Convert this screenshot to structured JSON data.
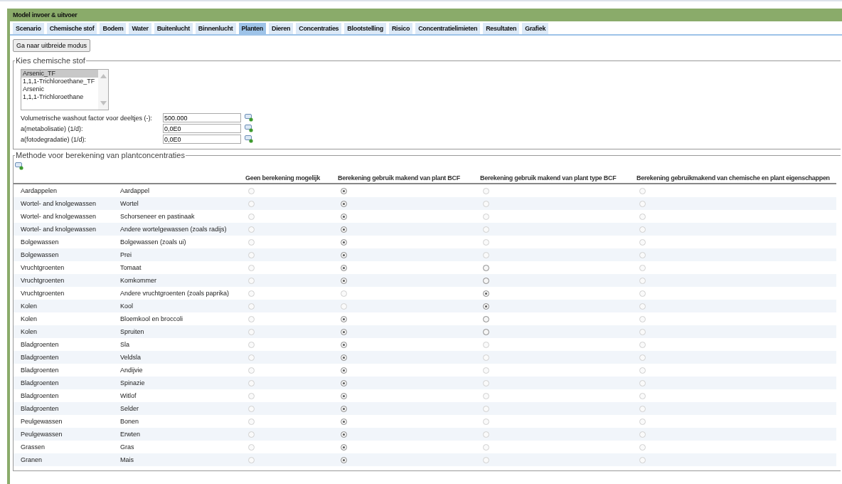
{
  "window": {
    "title": "Model invoer & uitvoer"
  },
  "tabs": [
    {
      "label": "Scenario",
      "selected": false
    },
    {
      "label": "Chemische stof",
      "selected": false
    },
    {
      "label": "Bodem",
      "selected": false
    },
    {
      "label": "Water",
      "selected": false
    },
    {
      "label": "Buitenlucht",
      "selected": false
    },
    {
      "label": "Binnenlucht",
      "selected": false
    },
    {
      "label": "Planten",
      "selected": true
    },
    {
      "label": "Dieren",
      "selected": false
    },
    {
      "label": "Concentraties",
      "selected": false
    },
    {
      "label": "Blootstelling",
      "selected": false
    },
    {
      "label": "Risico",
      "selected": false
    },
    {
      "label": "Concentratielimieten",
      "selected": false
    },
    {
      "label": "Resultaten",
      "selected": false
    },
    {
      "label": "Grafiek",
      "selected": false
    }
  ],
  "mode_button": "Ga naar uitbreide modus",
  "substance": {
    "legend": "Kies chemische stof",
    "options": [
      {
        "label": "Arsenic_TF",
        "selected": true
      },
      {
        "label": "1,1,1-Trichloroethane_TF",
        "selected": false
      },
      {
        "label": "Arsenic",
        "selected": false
      },
      {
        "label": "1,1,1-Trichloroethane",
        "selected": false
      }
    ],
    "fields": [
      {
        "label": "Volumetrische washout factor voor deeltjes (-):",
        "value": "500.000"
      },
      {
        "label": "a(metabolisatie) (1/d):",
        "value": "0,0E0"
      },
      {
        "label": "a(fotodegradatie) (1/d):",
        "value": "0,0E0"
      }
    ]
  },
  "method": {
    "legend": "Methode voor berekening van plantconcentraties",
    "columns": [
      "Geen berekening mogelijk",
      "Berekening gebruik makend van plant BCF",
      "Berekening gebruik makend van plant type BCF",
      "Berekening gebruikmakend van chemische en plant eigenschappen"
    ],
    "rows": [
      {
        "group": "Aardappelen",
        "plant": "Aardappel",
        "choices": [
          {
            "selected": false,
            "disabled": true
          },
          {
            "selected": true,
            "disabled": false
          },
          {
            "selected": false,
            "disabled": true
          },
          {
            "selected": false,
            "disabled": true
          }
        ]
      },
      {
        "group": "Wortel- and knolgewassen",
        "plant": "Wortel",
        "choices": [
          {
            "selected": false,
            "disabled": true
          },
          {
            "selected": true,
            "disabled": false
          },
          {
            "selected": false,
            "disabled": true
          },
          {
            "selected": false,
            "disabled": true
          }
        ]
      },
      {
        "group": "Wortel- and knolgewassen",
        "plant": "Schorseneer en pastinaak",
        "choices": [
          {
            "selected": false,
            "disabled": true
          },
          {
            "selected": true,
            "disabled": false
          },
          {
            "selected": false,
            "disabled": true
          },
          {
            "selected": false,
            "disabled": true
          }
        ]
      },
      {
        "group": "Wortel- and knolgewassen",
        "plant": "Andere wortelgewassen (zoals radijs)",
        "choices": [
          {
            "selected": false,
            "disabled": true
          },
          {
            "selected": true,
            "disabled": false
          },
          {
            "selected": false,
            "disabled": true
          },
          {
            "selected": false,
            "disabled": true
          }
        ]
      },
      {
        "group": "Bolgewassen",
        "plant": "Bolgewassen (zoals ui)",
        "choices": [
          {
            "selected": false,
            "disabled": true
          },
          {
            "selected": true,
            "disabled": false
          },
          {
            "selected": false,
            "disabled": true
          },
          {
            "selected": false,
            "disabled": true
          }
        ]
      },
      {
        "group": "Bolgewassen",
        "plant": "Prei",
        "choices": [
          {
            "selected": false,
            "disabled": true
          },
          {
            "selected": true,
            "disabled": false
          },
          {
            "selected": false,
            "disabled": true
          },
          {
            "selected": false,
            "disabled": true
          }
        ]
      },
      {
        "group": "Vruchtgroenten",
        "plant": "Tomaat",
        "choices": [
          {
            "selected": false,
            "disabled": true
          },
          {
            "selected": true,
            "disabled": false
          },
          {
            "selected": false,
            "disabled": false
          },
          {
            "selected": false,
            "disabled": true
          }
        ]
      },
      {
        "group": "Vruchtgroenten",
        "plant": "Komkommer",
        "choices": [
          {
            "selected": false,
            "disabled": true
          },
          {
            "selected": true,
            "disabled": false
          },
          {
            "selected": false,
            "disabled": false
          },
          {
            "selected": false,
            "disabled": true
          }
        ]
      },
      {
        "group": "Vruchtgroenten",
        "plant": "Andere vruchtgroenten (zoals paprika)",
        "choices": [
          {
            "selected": false,
            "disabled": true
          },
          {
            "selected": false,
            "disabled": true
          },
          {
            "selected": true,
            "disabled": false
          },
          {
            "selected": false,
            "disabled": true
          }
        ]
      },
      {
        "group": "Kolen",
        "plant": "Kool",
        "choices": [
          {
            "selected": false,
            "disabled": true
          },
          {
            "selected": false,
            "disabled": true
          },
          {
            "selected": true,
            "disabled": false
          },
          {
            "selected": false,
            "disabled": true
          }
        ]
      },
      {
        "group": "Kolen",
        "plant": "Bloemkool en broccoli",
        "choices": [
          {
            "selected": false,
            "disabled": true
          },
          {
            "selected": true,
            "disabled": false
          },
          {
            "selected": false,
            "disabled": false
          },
          {
            "selected": false,
            "disabled": true
          }
        ]
      },
      {
        "group": "Kolen",
        "plant": "Spruiten",
        "choices": [
          {
            "selected": false,
            "disabled": true
          },
          {
            "selected": true,
            "disabled": false
          },
          {
            "selected": false,
            "disabled": false
          },
          {
            "selected": false,
            "disabled": true
          }
        ]
      },
      {
        "group": "Bladgroenten",
        "plant": "Sla",
        "choices": [
          {
            "selected": false,
            "disabled": true
          },
          {
            "selected": true,
            "disabled": false
          },
          {
            "selected": false,
            "disabled": true
          },
          {
            "selected": false,
            "disabled": true
          }
        ]
      },
      {
        "group": "Bladgroenten",
        "plant": "Veldsla",
        "choices": [
          {
            "selected": false,
            "disabled": true
          },
          {
            "selected": true,
            "disabled": false
          },
          {
            "selected": false,
            "disabled": true
          },
          {
            "selected": false,
            "disabled": true
          }
        ]
      },
      {
        "group": "Bladgroenten",
        "plant": "Andijvie",
        "choices": [
          {
            "selected": false,
            "disabled": true
          },
          {
            "selected": true,
            "disabled": false
          },
          {
            "selected": false,
            "disabled": true
          },
          {
            "selected": false,
            "disabled": true
          }
        ]
      },
      {
        "group": "Bladgroenten",
        "plant": "Spinazie",
        "choices": [
          {
            "selected": false,
            "disabled": true
          },
          {
            "selected": true,
            "disabled": false
          },
          {
            "selected": false,
            "disabled": true
          },
          {
            "selected": false,
            "disabled": true
          }
        ]
      },
      {
        "group": "Bladgroenten",
        "plant": "Witlof",
        "choices": [
          {
            "selected": false,
            "disabled": true
          },
          {
            "selected": true,
            "disabled": false
          },
          {
            "selected": false,
            "disabled": true
          },
          {
            "selected": false,
            "disabled": true
          }
        ]
      },
      {
        "group": "Bladgroenten",
        "plant": "Selder",
        "choices": [
          {
            "selected": false,
            "disabled": true
          },
          {
            "selected": true,
            "disabled": false
          },
          {
            "selected": false,
            "disabled": true
          },
          {
            "selected": false,
            "disabled": true
          }
        ]
      },
      {
        "group": "Peulgewassen",
        "plant": "Bonen",
        "choices": [
          {
            "selected": false,
            "disabled": true
          },
          {
            "selected": true,
            "disabled": false
          },
          {
            "selected": false,
            "disabled": true
          },
          {
            "selected": false,
            "disabled": true
          }
        ]
      },
      {
        "group": "Peulgewassen",
        "plant": "Erwten",
        "choices": [
          {
            "selected": false,
            "disabled": true
          },
          {
            "selected": true,
            "disabled": false
          },
          {
            "selected": false,
            "disabled": true
          },
          {
            "selected": false,
            "disabled": true
          }
        ]
      },
      {
        "group": "Grassen",
        "plant": "Gras",
        "choices": [
          {
            "selected": false,
            "disabled": true
          },
          {
            "selected": true,
            "disabled": false
          },
          {
            "selected": false,
            "disabled": true
          },
          {
            "selected": false,
            "disabled": true
          }
        ]
      },
      {
        "group": "Granen",
        "plant": "Mais",
        "choices": [
          {
            "selected": false,
            "disabled": true
          },
          {
            "selected": true,
            "disabled": false
          },
          {
            "selected": false,
            "disabled": true
          },
          {
            "selected": false,
            "disabled": true
          }
        ]
      }
    ]
  }
}
